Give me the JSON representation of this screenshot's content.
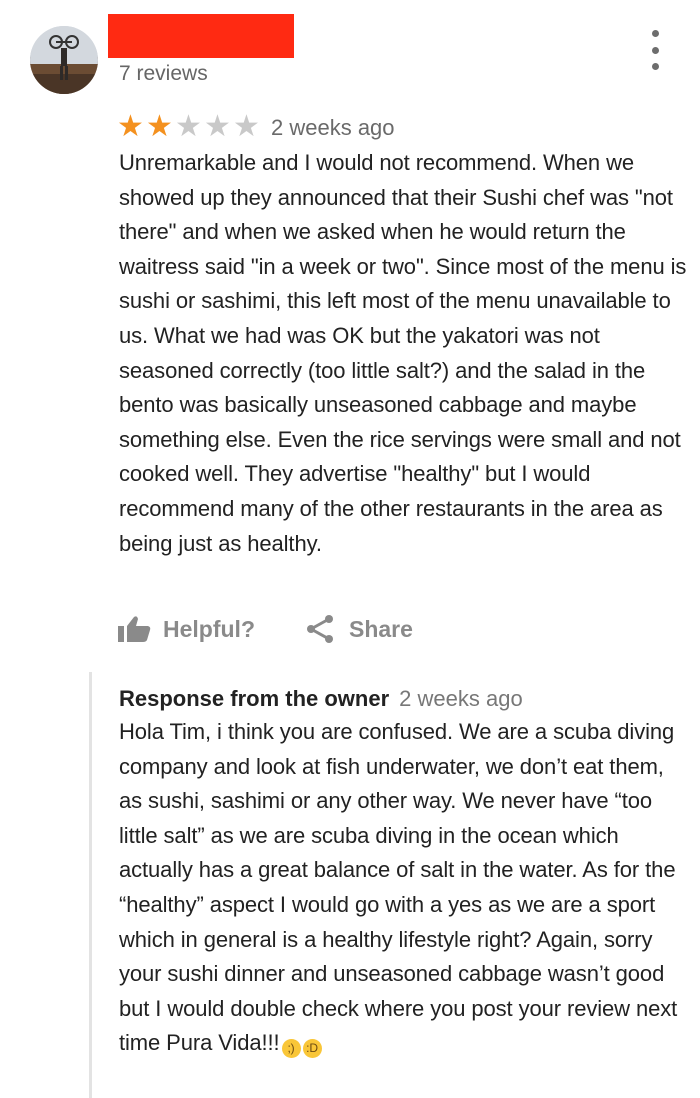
{
  "reviewer": {
    "reviews_count": "7 reviews"
  },
  "review": {
    "rating": 2,
    "rating_max": 5,
    "date": "2 weeks ago",
    "text": "Unremarkable and I would not recommend. When we showed up they announced that their Sushi chef was \"not there\" and when we asked when he would return the waitress said \"in a week or two\". Since most of the menu is sushi or sashimi, this left most of the menu unavailable to us. What we had was OK but the yakatori was not seasoned correctly (too little salt?) and the salad in the bento was basically unseasoned cabbage and maybe something else. Even the rice servings were small and not cooked well.  They advertise \"healthy\" but I would recommend many of the other restaurants in the area as being just as healthy."
  },
  "actions": {
    "helpful_label": "Helpful?",
    "share_label": "Share"
  },
  "owner_response": {
    "title": "Response from the owner",
    "date": "2 weeks ago",
    "text": "Hola Tim, i think you are confused. We are a scuba diving company and look at fish underwater, we don’t eat them, as sushi, sashimi or any other way. We never have “too little salt” as we are scuba diving in the ocean which actually has a great balance of salt in the water. As for the “healthy” aspect I would go with a yes as we are a sport which in general is a healthy lifestyle right? Again, sorry your sushi dinner and unseasoned cabbage wasn’t good but I would double check where you post your review next time Pura Vida!!!"
  },
  "icons": {
    "menu": "more-vertical-icon",
    "helpful": "thumbs-up-icon",
    "share": "share-icon",
    "emoji_1": "winking-face-emoji",
    "emoji_2": "grinning-face-emoji"
  },
  "colors": {
    "star_filled": "#f4911f",
    "star_empty": "#c9c9c9",
    "redaction": "#ff2a12",
    "action_gray": "#8a8a8a"
  }
}
